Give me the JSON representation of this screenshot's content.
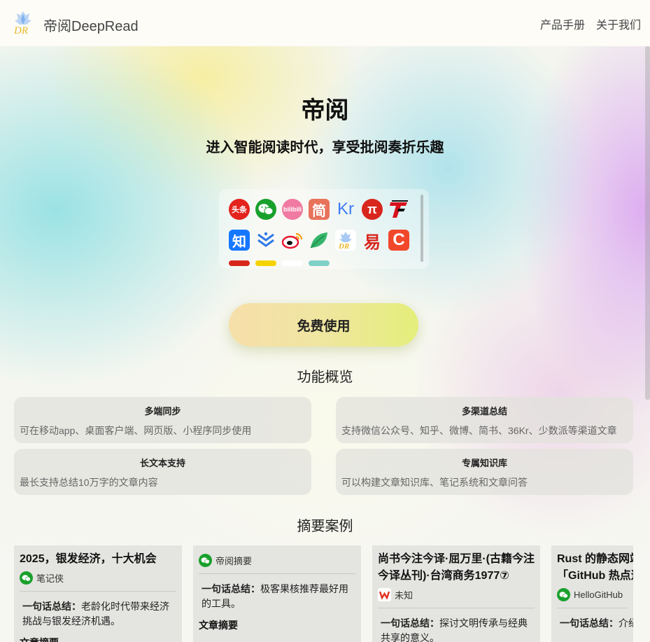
{
  "header": {
    "brand": "帝阅DeepRead",
    "logo_text": "DR",
    "nav": [
      "产品手册",
      "关于我们"
    ]
  },
  "hero": {
    "title": "帝阅",
    "subtitle": "进入智能阅读时代，享受批阅奏折乐趣"
  },
  "sources": [
    {
      "icon": "toutiao-icon",
      "label": "头条",
      "bg": "#e3231c",
      "round": true
    },
    {
      "icon": "wechat-icon",
      "label": "",
      "bg": "#19a02c",
      "round": true
    },
    {
      "icon": "bilibili-icon",
      "label": "bilibili",
      "bg": "#f07aa1",
      "round": true
    },
    {
      "icon": "jianshu-icon",
      "label": "简",
      "bg": "#e8735a",
      "round": false
    },
    {
      "icon": "36kr-icon",
      "label": "Kr",
      "bg": "transparent",
      "round": false
    },
    {
      "icon": "pi-icon",
      "label": "π",
      "bg": "#d8261c",
      "round": true
    },
    {
      "icon": "tf-icon",
      "label": "TF",
      "bg": "transparent",
      "round": false
    },
    {
      "icon": "zhihu-icon",
      "label": "知",
      "bg": "#1677ff",
      "round": false
    },
    {
      "icon": "chevron-stack-icon",
      "label": "",
      "bg": "transparent",
      "round": false
    },
    {
      "icon": "weibo-icon",
      "label": "",
      "bg": "transparent",
      "round": false
    },
    {
      "icon": "leaf-icon",
      "label": "",
      "bg": "transparent",
      "round": false
    },
    {
      "icon": "deepread-icon",
      "label": "DR",
      "bg": "#ffffff",
      "round": false
    },
    {
      "icon": "red-glyph-icon",
      "label": "易",
      "bg": "transparent",
      "round": false
    },
    {
      "icon": "c-icon",
      "label": "C",
      "bg": "#f1482c",
      "round": false
    }
  ],
  "cta": {
    "label": "免费使用"
  },
  "features": {
    "title": "功能概览",
    "items": [
      {
        "title": "多端同步",
        "desc": "可在移动app、桌面客户端、网页版、小程序同步使用"
      },
      {
        "title": "多渠道总结",
        "desc": "支持微信公众号、知乎、微博、简书、36Kr、少数派等渠道文章"
      },
      {
        "title": "长文本支持",
        "desc": "最长支持总结10万字的文章内容"
      },
      {
        "title": "专属知识库",
        "desc": "可以构建文章知识库、笔记系统和文章问答"
      }
    ]
  },
  "cases": {
    "title": "摘要案例",
    "items": [
      {
        "title": "2025，银发经济，十大机会",
        "source": "笔记侠",
        "source_icon": "wechat-icon",
        "summary_label": "一句话总结：",
        "summary": "老龄化时代带来经济挑战与银发经济机遇。",
        "section": "文章摘要"
      },
      {
        "title": "",
        "source": "帝阅摘要",
        "source_icon": "wechat-icon",
        "summary_label": "一句话总结：",
        "summary": "极客果核推荐最好用的工具。",
        "section": "文章摘要"
      },
      {
        "title": "尚书今注今译·屈万里·(古籍今注今译丛刊)·台湾商务1977⑦",
        "source": "未知",
        "source_icon": "wps-icon",
        "summary_label": "一句话总结：",
        "summary": "探讨文明传承与经典共享的意义。",
        "section": ""
      },
      {
        "title": "Rust 的静态网站「GitHub 热点速览」",
        "source": "HelloGitHub",
        "source_icon": "wechat-icon",
        "summary_label": "一句话总结：",
        "summary": "介绍开源项目及工具。",
        "section": ""
      }
    ]
  }
}
